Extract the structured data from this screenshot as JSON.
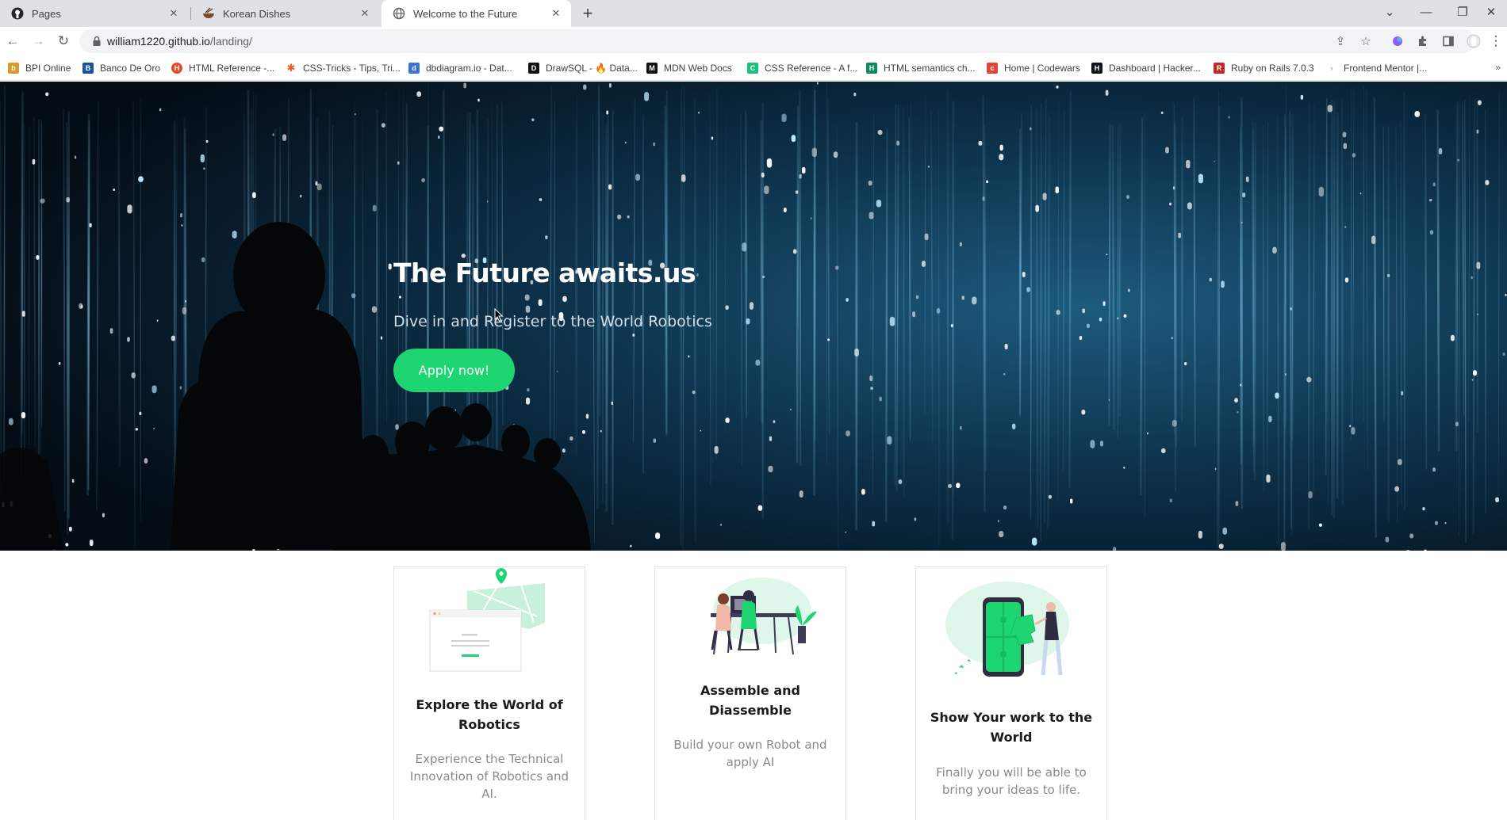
{
  "browser": {
    "tabs": [
      {
        "title": "Pages",
        "icon": "github-icon",
        "active": false
      },
      {
        "title": "Korean Dishes",
        "icon": "korean-dish-icon",
        "active": false
      },
      {
        "title": "Welcome to the Future",
        "icon": "globe-icon",
        "active": true
      }
    ],
    "url_host": "william1220.github.io",
    "url_path": "/landing/",
    "bookmarks": [
      {
        "label": "BPI Online",
        "icon": "bpi-icon",
        "color": "#d99a2b"
      },
      {
        "label": "Banco De Oro",
        "icon": "bdo-icon",
        "color": "#1f4fa0"
      },
      {
        "label": "HTML Reference -...",
        "icon": "html-ref-icon",
        "color": "#e34c26"
      },
      {
        "label": "CSS-Tricks - Tips, Tri...",
        "icon": "css-tricks-icon",
        "color": "#f05a28"
      },
      {
        "label": "dbdiagram.io - Dat...",
        "icon": "dbdiagram-icon",
        "color": "#3b73d8"
      },
      {
        "label": "DrawSQL - 🔥 Data...",
        "icon": "drawsql-icon",
        "color": "#111111"
      },
      {
        "label": "MDN Web Docs",
        "icon": "mdn-icon",
        "color": "#111111"
      },
      {
        "label": "CSS Reference - A f...",
        "icon": "css-reference-icon",
        "color": "#19c37d"
      },
      {
        "label": "HTML semantics ch...",
        "icon": "html-semantics-icon",
        "color": "#0f8a5f"
      },
      {
        "label": "Home | Codewars",
        "icon": "codewars-icon",
        "color": "#e0453a"
      },
      {
        "label": "Dashboard | Hacker...",
        "icon": "hackerrank-icon",
        "color": "#0e141e"
      },
      {
        "label": "Ruby on Rails 7.0.3",
        "icon": "rails-icon",
        "color": "#c62828"
      },
      {
        "label": "Frontend Mentor |...",
        "icon": "frontend-mentor-icon",
        "color": "#9aa0a6"
      }
    ]
  },
  "hero": {
    "title": "The Future awaits.us",
    "subtitle": "Dive in and Register to the World Robotics",
    "cta_label": "Apply now!"
  },
  "cards": [
    {
      "title": "Explore the World of Robotics",
      "text": "Experience the Technical Innovation of Robotics and AI."
    },
    {
      "title": "Assemble and Diassemble",
      "text": "Build your own Robot and apply AI"
    },
    {
      "title": "Show Your work to the World",
      "text": "Finally you will be able to bring your ideas to life."
    }
  ],
  "colors": {
    "accent": "#1dd672",
    "hero_bg": "#061420",
    "tabstrip": "#dee1e6"
  }
}
